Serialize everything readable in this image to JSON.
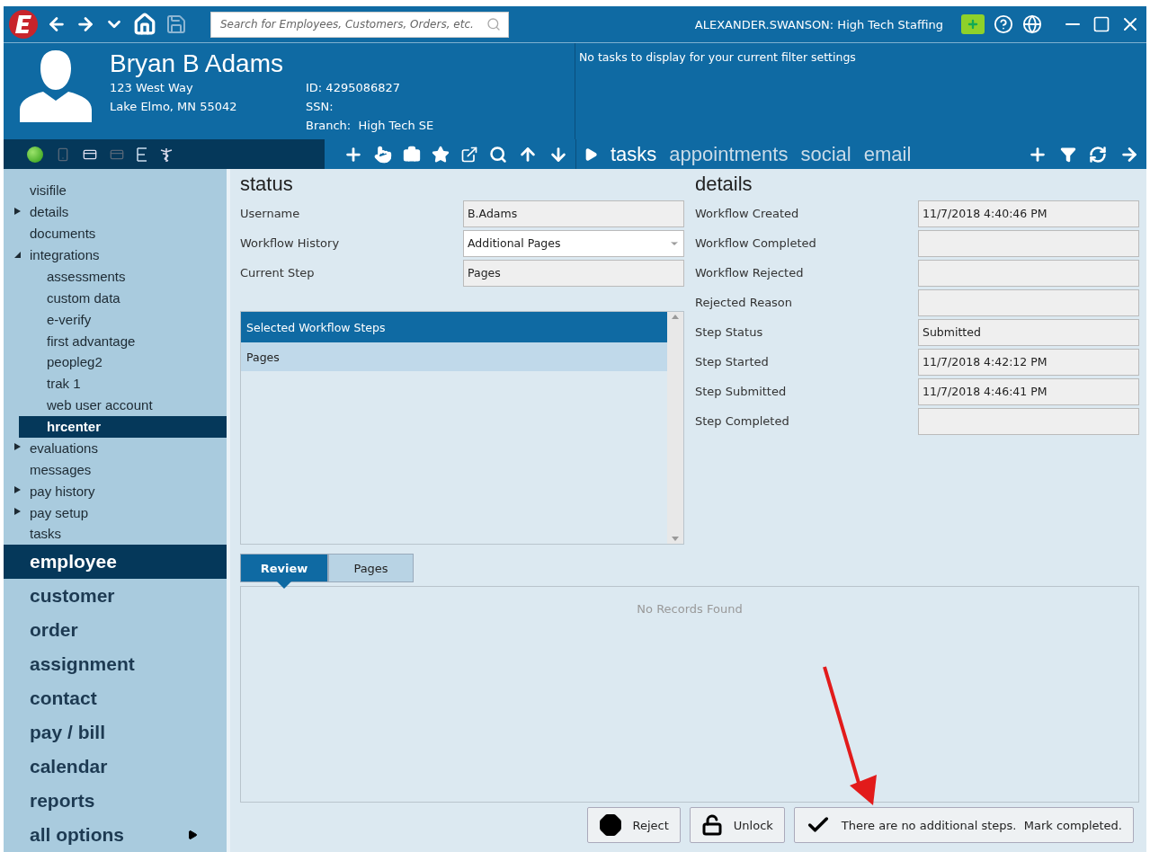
{
  "title_bar": {
    "search": {
      "placeholder": "Search for Employees, Customers, Orders, etc."
    },
    "user": "ALEXANDER.SWANSON: High Tech Staffing"
  },
  "record": {
    "name": "Bryan B Adams",
    "address_line_1": "123 West Way",
    "address_line_2": "Lake Elmo, MN 55042",
    "id": "ID: 4295086827",
    "ssn": "SSN:",
    "branch_label": "Branch:",
    "branch": "High Tech SE",
    "online": true
  },
  "activity": {
    "message": "No tasks to display for your current filter settings",
    "tabs": [
      {
        "label": "tasks",
        "selected": true
      },
      {
        "label": "appointments",
        "selected": false
      },
      {
        "label": "social",
        "selected": false
      },
      {
        "label": "email",
        "selected": false
      }
    ]
  },
  "nav_tree": [
    {
      "label": "visifile",
      "selected": false
    },
    {
      "label": "details",
      "expanded": false,
      "selected": false
    },
    {
      "label": "documents",
      "selected": false
    },
    {
      "label": "integrations",
      "expanded": true,
      "selected": false,
      "children": [
        {
          "label": "assessments",
          "selected": false
        },
        {
          "label": "custom data",
          "selected": false
        },
        {
          "label": "e-verify",
          "selected": false
        },
        {
          "label": "first advantage",
          "selected": false
        },
        {
          "label": "peopleg2",
          "selected": false
        },
        {
          "label": "trak 1",
          "selected": false
        },
        {
          "label": "web user account",
          "selected": false
        },
        {
          "label": "hrcenter",
          "selected": true
        }
      ]
    },
    {
      "label": "evaluations",
      "expanded": false,
      "selected": false
    },
    {
      "label": "messages",
      "selected": false
    },
    {
      "label": "pay history",
      "expanded": false,
      "selected": false
    },
    {
      "label": "pay setup",
      "expanded": false,
      "selected": false
    },
    {
      "label": "tasks",
      "selected": false
    }
  ],
  "modules": [
    {
      "label": "employee",
      "selected": true
    },
    {
      "label": "customer",
      "selected": false
    },
    {
      "label": "order",
      "selected": false
    },
    {
      "label": "assignment",
      "selected": false
    },
    {
      "label": "contact",
      "selected": false
    },
    {
      "label": "pay / bill",
      "selected": false
    },
    {
      "label": "calendar",
      "selected": false
    },
    {
      "label": "reports",
      "selected": false
    },
    {
      "label": "all options",
      "selected": false,
      "submenu": true
    }
  ],
  "status": {
    "title": "status",
    "fields": [
      {
        "label": "Username",
        "value": "B.Adams",
        "kind": "text"
      },
      {
        "label": "Workflow History",
        "value": "Additional Pages",
        "kind": "dropdown"
      },
      {
        "label": "Current Step",
        "value": "Pages",
        "kind": "text"
      }
    ],
    "steps": {
      "header": "Selected Workflow Steps",
      "rows": [
        {
          "label": "Pages",
          "selected": true
        }
      ]
    }
  },
  "details": {
    "title": "details",
    "fields": [
      {
        "label": "Workflow Created",
        "value": "11/7/2018 4:40:46 PM"
      },
      {
        "label": "Workflow Completed"
      },
      {
        "label": "Workflow Rejected"
      },
      {
        "label": "Rejected Reason"
      },
      {
        "label": "Step Status",
        "value": "Submitted"
      },
      {
        "label": "Step Started",
        "value": "11/7/2018 4:42:12 PM"
      },
      {
        "label": "Step Submitted",
        "value": "11/7/2018 4:46:41 PM"
      },
      {
        "label": "Step Completed"
      }
    ]
  },
  "review": {
    "tabs": [
      {
        "label": "Review",
        "selected": true
      },
      {
        "label": "Pages",
        "selected": false
      }
    ],
    "empty_message": "No Records Found"
  },
  "actions": [
    {
      "kind": "reject",
      "label": "Reject"
    },
    {
      "kind": "unlock",
      "label": "Unlock"
    },
    {
      "kind": "complete",
      "label": "There are no additional steps.  Mark completed."
    }
  ]
}
